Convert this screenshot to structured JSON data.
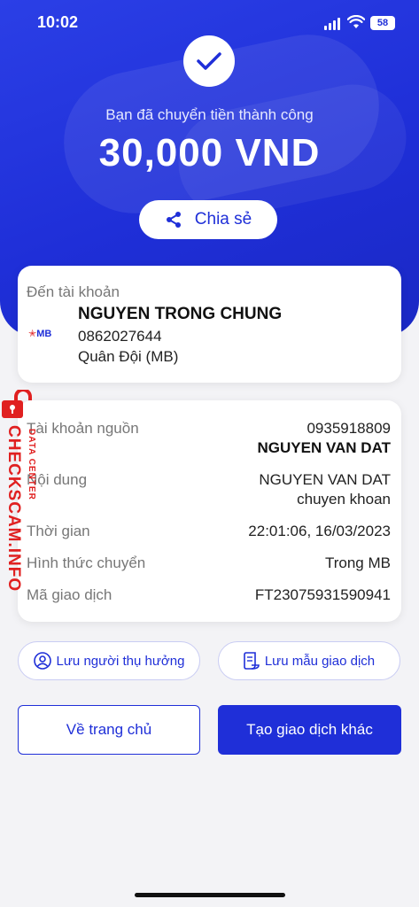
{
  "status": {
    "time": "10:02",
    "battery": "58"
  },
  "hero": {
    "message": "Bạn đã chuyển tiền thành công",
    "amount": "30,000 VND",
    "share_label": "Chia sẻ"
  },
  "recipient": {
    "label": "Đến tài khoản",
    "bank_logo_text": "MB",
    "name": "NGUYEN TRONG CHUNG",
    "account": "0862027644",
    "bank": "Quân Đội (MB)"
  },
  "details": {
    "source_label": "Tài khoản nguồn",
    "source_account": "0935918809",
    "source_name": "NGUYEN VAN DAT",
    "content_label": "Nội dung",
    "content_line1": "NGUYEN VAN DAT",
    "content_line2": "chuyen khoan",
    "time_label": "Thời gian",
    "time_value": "22:01:06, 16/03/2023",
    "method_label": "Hình thức chuyển",
    "method_value": "Trong MB",
    "txn_label": "Mã giao dịch",
    "txn_value": "FT23075931590941"
  },
  "watermark": {
    "main": "CHECKSCAM.INFO",
    "sub": "DATA CENTER"
  },
  "actions": {
    "save_beneficiary": "Lưu người thụ hưởng",
    "save_template": "Lưu mẫu giao dịch",
    "home": "Về trang chủ",
    "new_transaction": "Tạo giao dịch khác"
  },
  "colors": {
    "primary": "#1f2fd8",
    "watermark": "#e02020"
  }
}
